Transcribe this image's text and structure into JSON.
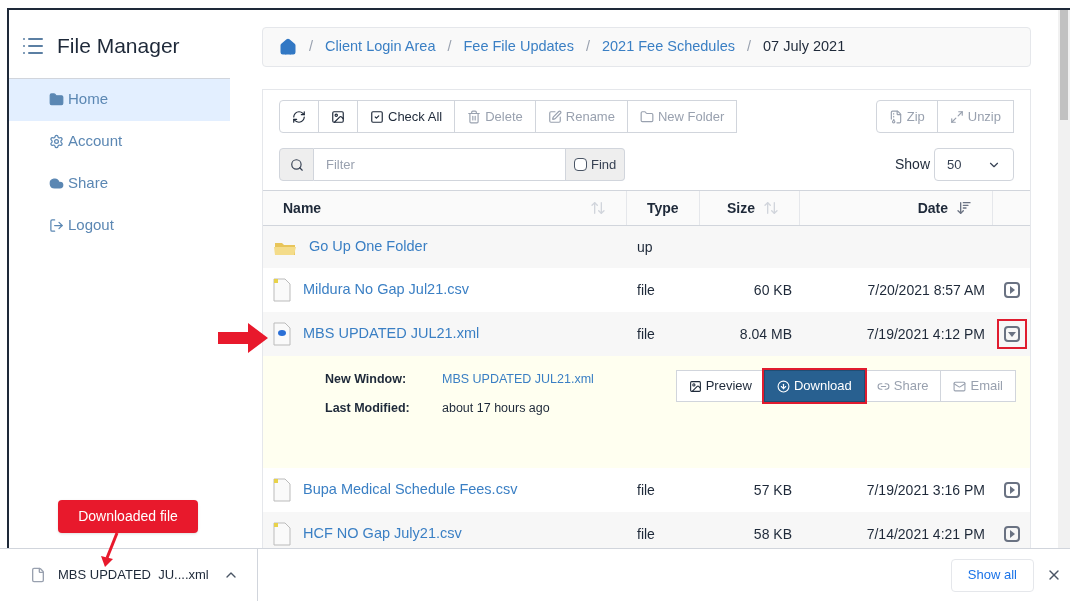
{
  "app": {
    "title": "File Manager"
  },
  "sidebar": {
    "items": [
      {
        "label": "Home",
        "kind": "folder",
        "selected": true
      },
      {
        "label": "Account",
        "kind": "gear",
        "selected": false
      },
      {
        "label": "Share",
        "kind": "cloud",
        "selected": false
      },
      {
        "label": "Logout",
        "kind": "logout",
        "selected": false
      }
    ]
  },
  "breadcrumb": {
    "separator": "/",
    "links": [
      "Client Login Area",
      "Fee File Updates",
      "2021 Fee Schedules"
    ],
    "current": "07 July 2021"
  },
  "toolbar": {
    "left": [
      {
        "kind": "refresh",
        "disabled": false
      },
      {
        "kind": "image",
        "disabled": false
      },
      {
        "kind": "check",
        "label": "Check All",
        "disabled": false
      },
      {
        "kind": "trash",
        "label": "Delete",
        "disabled": true
      },
      {
        "kind": "edit",
        "label": "Rename",
        "disabled": true
      },
      {
        "kind": "folder",
        "label": "New Folder",
        "disabled": true
      }
    ],
    "right": [
      {
        "kind": "zip",
        "label": "Zip",
        "disabled": true
      },
      {
        "kind": "expand",
        "label": "Unzip",
        "disabled": true
      }
    ]
  },
  "filter": {
    "placeholder": "Filter",
    "find_label": "Find",
    "find_checked": false,
    "show_label": "Show",
    "show_value": "50"
  },
  "table": {
    "columns": [
      {
        "label": "Name",
        "sortable": true,
        "sorted_descending": false
      },
      {
        "label": "Type"
      },
      {
        "label": "Size",
        "sortable": true,
        "sorted_descending": false
      },
      {
        "label": "Date",
        "sortable": true,
        "sorted_descending": true
      }
    ],
    "rows": [
      {
        "kind": "folder",
        "name": "Go Up One Folder",
        "type": "up"
      },
      {
        "kind": "sheet",
        "name": "Mildura No Gap Jul21.csv",
        "type": "file",
        "size": "60 KB",
        "date": "7/20/2021 8:57 AM",
        "expanded": false,
        "highlighted": false
      },
      {
        "kind": "xml",
        "name": "MBS UPDATED JUL21.xml",
        "type": "file",
        "size": "8.04 MB",
        "date": "7/19/2021 4:12 PM",
        "expanded": true,
        "highlighted": true,
        "details": {
          "new_window_label": "New Window:",
          "new_window_link": "MBS UPDATED JUL21.xml",
          "modified_label": "Last Modified:",
          "modified_value": "about 17 hours ago",
          "actions": [
            {
              "kind": "image",
              "label": "Preview",
              "primary": false,
              "disabled": false,
              "highlighted": false
            },
            {
              "kind": "download",
              "label": "Download",
              "primary": true,
              "disabled": false,
              "highlighted": true
            },
            {
              "kind": "link",
              "label": "Share",
              "primary": false,
              "disabled": true,
              "highlighted": false
            },
            {
              "kind": "mail",
              "label": "Email",
              "primary": false,
              "disabled": true,
              "highlighted": false
            }
          ]
        }
      },
      {
        "kind": "sheet",
        "name": "Bupa Medical Schedule Fees.csv",
        "type": "file",
        "size": "57 KB",
        "date": "7/19/2021 3:16 PM",
        "expanded": false,
        "highlighted": false
      },
      {
        "kind": "sheet",
        "name": "HCF NO Gap July21.csv",
        "type": "file",
        "size": "58 KB",
        "date": "7/14/2021 4:21 PM",
        "expanded": false,
        "highlighted": false
      }
    ]
  },
  "callout": {
    "text": "Downloaded file"
  },
  "download_bar": {
    "file": "MBS UPDATED  JU....xml",
    "show_all": "Show all"
  }
}
